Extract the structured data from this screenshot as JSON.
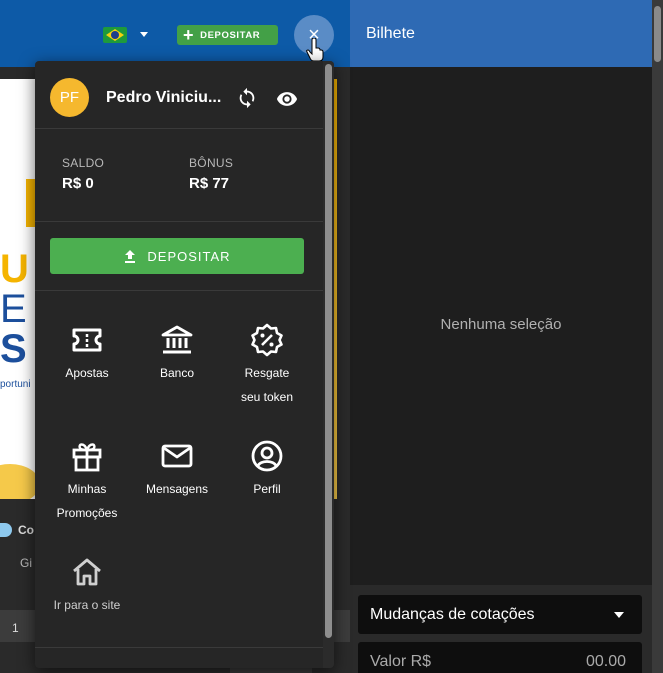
{
  "header": {
    "deposit_label": "DEPOSITAR",
    "close_label": "×"
  },
  "background": {
    "banner_letters": [
      "U",
      "E",
      "S"
    ],
    "banner_fragment": "portuni",
    "league_text": "Co",
    "sub_text": "Gi",
    "page_number": "1"
  },
  "bet_slip": {
    "title": "Bilhete",
    "empty_text": "Nenhuma seleção",
    "odds_changes_select": "Mudanças de cotações",
    "stake_label": "Valor R$",
    "stake_value": "00.00"
  },
  "account_menu": {
    "avatar_initials": "PF",
    "user_name": "Pedro Viniciu...",
    "balance_label": "SALDO",
    "balance_value": "R$ 0",
    "bonus_label": "BÔNUS",
    "bonus_value": "R$ 77",
    "deposit_label": "DEPOSITAR",
    "items": [
      {
        "line1": "Apostas",
        "line2": "",
        "icon": "ticket-icon"
      },
      {
        "line1": "Banco",
        "line2": "",
        "icon": "bank-icon"
      },
      {
        "line1": "Resgate",
        "line2": "seu token",
        "icon": "discount-badge-icon"
      },
      {
        "line1": "Minhas",
        "line2": "Promoções",
        "icon": "gift-icon"
      },
      {
        "line1": "Mensagens",
        "line2": "",
        "icon": "envelope-icon"
      },
      {
        "line1": "Perfil",
        "line2": "",
        "icon": "user-circle-icon"
      },
      {
        "line1": "Ir para o site",
        "line2": "",
        "icon": "home-icon"
      }
    ]
  },
  "colors": {
    "brand_blue": "#0d5aa7",
    "slip_header": "#2e6ab4",
    "deposit_green": "#4caf50",
    "avatar_yellow": "#f5b82e"
  }
}
